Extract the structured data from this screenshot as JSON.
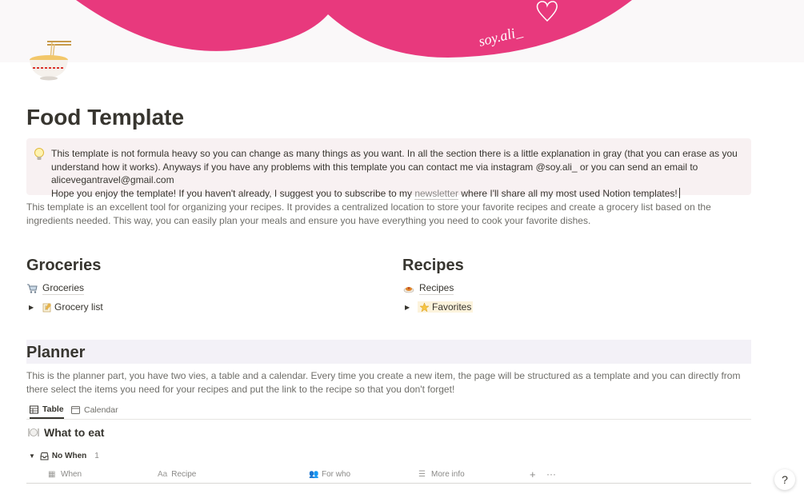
{
  "cover": {
    "signature": "soy.ali_",
    "accent_color": "#e8397d"
  },
  "page": {
    "icon": "noodle-bowl-icon",
    "title": "Food Template"
  },
  "callout": {
    "icon": "lightbulb-icon",
    "line1": "This template is not formula heavy so you can change as many things as you want. In all the section there is a little explanation in gray (that you can erase as you understand how it works). Anyways if you have any problems with this template you can contact me via instagram @soy.ali_ or you can send an email to alicevegantravel@gmail.com",
    "line2_before": "Hope you enjoy the template! If you haven't already, I suggest you to subscribe to my ",
    "line2_link": "newsletter",
    "line2_after": " where I'll share all my most used Notion templates!"
  },
  "description": "This template is an excellent tool for organizing your recipes. It provides a centralized location to store your favorite recipes and create a grocery list based on the ingredients needed. This way, you can easily plan your meals and ensure you have everything you need to cook your favorite dishes.",
  "groceries": {
    "heading": "Groceries",
    "link": {
      "icon": "shopping-cart-icon",
      "label": "Groceries"
    },
    "toggle": {
      "icon": "memo-icon",
      "label": "Grocery list"
    }
  },
  "recipes": {
    "heading": "Recipes",
    "link": {
      "icon": "pasta-plate-icon",
      "label": "Recipes"
    },
    "toggle": {
      "icon": "star-icon",
      "label": "Favorites"
    }
  },
  "planner": {
    "heading": "Planner",
    "description": "This is the planner part, you have two vies, a table and a calendar. Every time you create a new item, the page will be structured as a template and you can directly from there select the items you need for your recipes and put the link to the recipe so that you don't forget!",
    "tabs": [
      {
        "label": "Table",
        "icon": "table-icon"
      },
      {
        "label": "Calendar",
        "icon": "calendar-icon"
      }
    ],
    "database": {
      "icon": "plate-cutlery-icon",
      "title": "What to eat",
      "group": {
        "icon": "inbox-icon",
        "label": "No When",
        "count": "1"
      },
      "columns": [
        {
          "label": "When",
          "icon_text": "▦"
        },
        {
          "label": "Recipe",
          "icon_text": "Aa"
        },
        {
          "label": "For who",
          "icon_text": "👥"
        },
        {
          "label": "More info",
          "icon_text": "☰"
        }
      ],
      "add_column": "+",
      "more": "···"
    }
  },
  "help": {
    "label": "?"
  }
}
